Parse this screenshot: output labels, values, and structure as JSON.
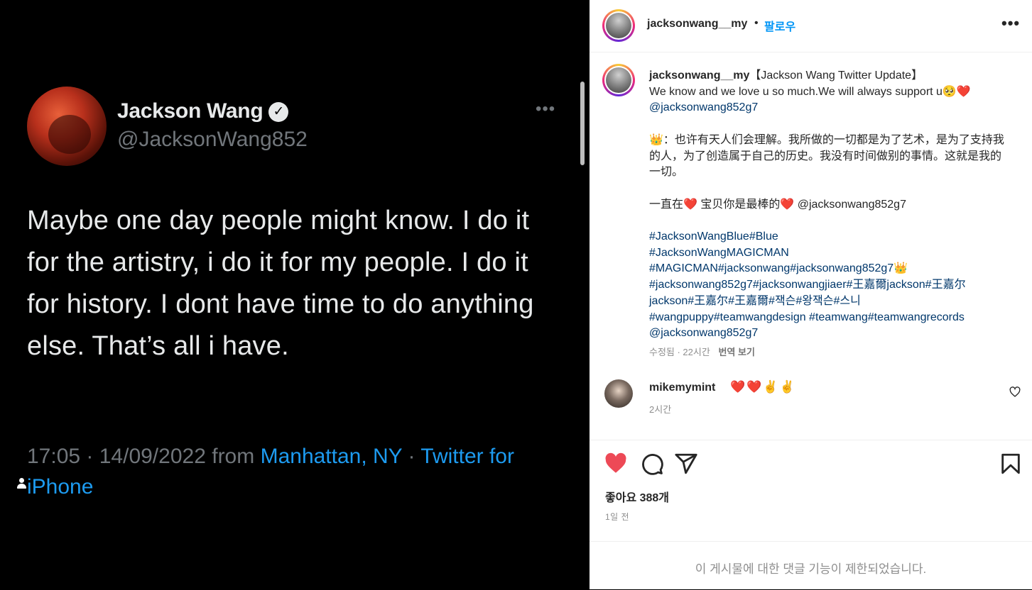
{
  "tweet": {
    "display_name": "Jackson Wang",
    "handle": "@JacksonWang852",
    "text": "Maybe one day people might know. I do it for the artistry, i do it for my people. I do it for history. I dont have time to do anything else. That’s all i have.",
    "timestamp": "17:05 · 14/09/2022",
    "from_label": "from",
    "location": "Manhattan, NY",
    "separator": "·",
    "source": "Twitter for iPhone"
  },
  "post": {
    "username": "jacksonwang__my",
    "dot": "•",
    "follow_label": "팔로우",
    "caption": {
      "username": "jacksonwang__my",
      "lines": [
        "【Jackson Wang Twitter Update】",
        "We know and we love u so much.We will always support u🥺❤️",
        "@jacksonwang852g7",
        "",
        "👑：也许有天人们会理解。我所做的一切都是为了艺术，是为了支持我的人，为了创造属于自己的历史。我没有时间做别的事情。这就是我的一切。",
        "",
        "一直在❤️ 宝贝你是最棒的❤️ @jacksonwang852g7",
        "",
        "#JacksonWangBlue#Blue",
        "#JacksonWangMAGICMAN",
        "#MAGICMAN#jacksonwang#jacksonwang852g7👑",
        "#jacksonwang852g7#jacksonwangjiaer#王嘉爾jackson#王嘉尔",
        "jackson#王嘉尔#王嘉爾#잭슨#왕잭슨#스니",
        "#wangpuppy#teamwangdesign #teamwang#teamwangrecords",
        "@jacksonwang852g7"
      ],
      "edited": "수정됨 · 22시간",
      "translate": "번역 보기"
    },
    "comment": {
      "username": "mikemymint",
      "text": "❤️❤️✌️✌️",
      "time": "2시간"
    },
    "likes": "좋아요 388개",
    "posted_ago": "1일 전",
    "comments_disabled": "이 게시물에 대한 댓글 기능이 제한되었습니다.",
    "colors": {
      "like_red": "#ed4956",
      "link_blue": "#0095f6",
      "tag_blue": "#00376b",
      "twitter_link": "#1d9bf0"
    }
  }
}
